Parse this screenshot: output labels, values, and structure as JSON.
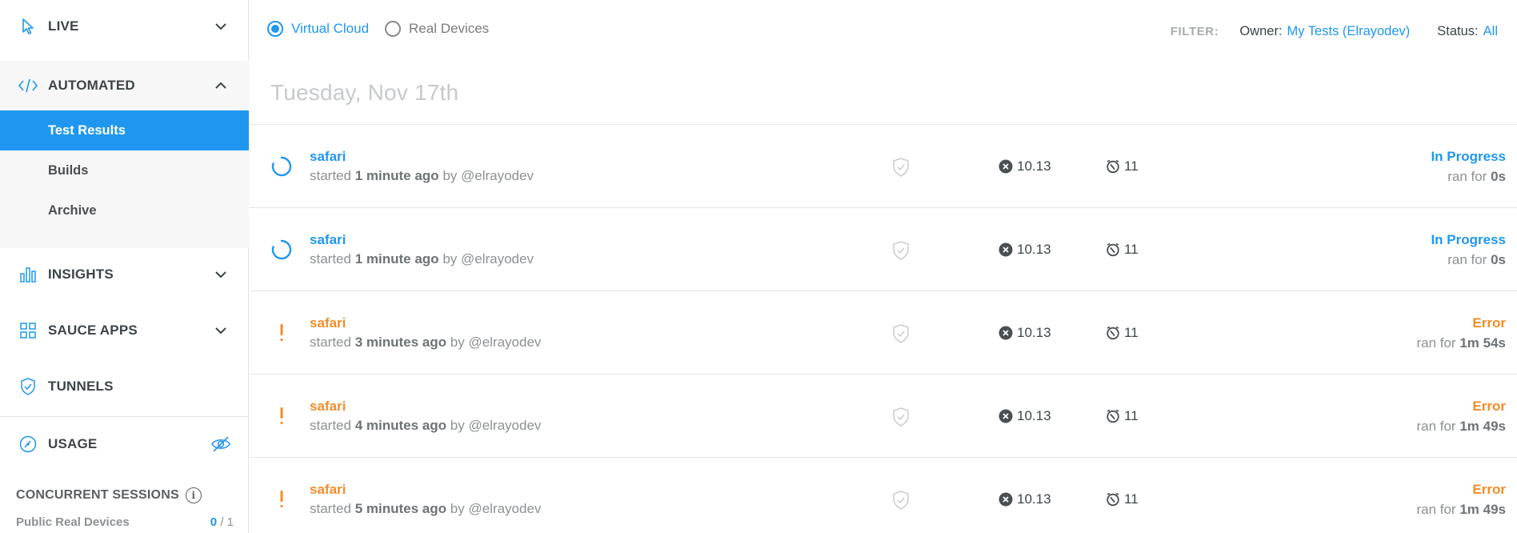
{
  "colors": {
    "accent": "#1f97f0",
    "error": "#f28c28",
    "muted": "#8d9193"
  },
  "sidebar": {
    "nav": [
      {
        "label": "LIVE",
        "icon": "cursor-icon"
      },
      {
        "label": "AUTOMATED",
        "icon": "code-icon"
      },
      {
        "label": "INSIGHTS",
        "icon": "bar-chart-icon"
      },
      {
        "label": "SAUCE APPS",
        "icon": "apps-grid-icon"
      },
      {
        "label": "TUNNELS",
        "icon": "shield-icon"
      },
      {
        "label": "USAGE",
        "icon": "gauge-icon"
      }
    ],
    "subnav": [
      "Test Results",
      "Builds",
      "Archive"
    ],
    "concurrent_label": "CONCURRENT SESSIONS",
    "public_devices_label": "Public Real Devices",
    "public_devices_used": "0",
    "public_devices_total": "/ 1"
  },
  "main": {
    "radios": [
      {
        "label": "Virtual Cloud",
        "checked": true
      },
      {
        "label": "Real Devices",
        "checked": false
      }
    ],
    "filter": {
      "label": "FILTER:",
      "owner_key": "Owner:",
      "owner_value": "My Tests (Elrayodev)",
      "status_key": "Status:",
      "status_value": "All"
    },
    "date_heading": "Tuesday, Nov 17th",
    "tests": [
      {
        "name": "safari",
        "started_prefix": "started",
        "started": "1 minute ago",
        "by": "by @elrayodev",
        "os_version": "10.13",
        "browser_version": "11",
        "status": "In Progress",
        "ran_prefix": "ran for",
        "duration": "0s",
        "state": "progress"
      },
      {
        "name": "safari",
        "started_prefix": "started",
        "started": "1 minute ago",
        "by": "by @elrayodev",
        "os_version": "10.13",
        "browser_version": "11",
        "status": "In Progress",
        "ran_prefix": "ran for",
        "duration": "0s",
        "state": "progress"
      },
      {
        "name": "safari",
        "started_prefix": "started",
        "started": "3 minutes ago",
        "by": "by @elrayodev",
        "os_version": "10.13",
        "browser_version": "11",
        "status": "Error",
        "ran_prefix": "ran for",
        "duration": "1m 54s",
        "state": "error"
      },
      {
        "name": "safari",
        "started_prefix": "started",
        "started": "4 minutes ago",
        "by": "by @elrayodev",
        "os_version": "10.13",
        "browser_version": "11",
        "status": "Error",
        "ran_prefix": "ran for",
        "duration": "1m 49s",
        "state": "error"
      },
      {
        "name": "safari",
        "started_prefix": "started",
        "started": "5 minutes ago",
        "by": "by @elrayodev",
        "os_version": "10.13",
        "browser_version": "11",
        "status": "Error",
        "ran_prefix": "ran for",
        "duration": "1m 49s",
        "state": "error"
      }
    ]
  }
}
